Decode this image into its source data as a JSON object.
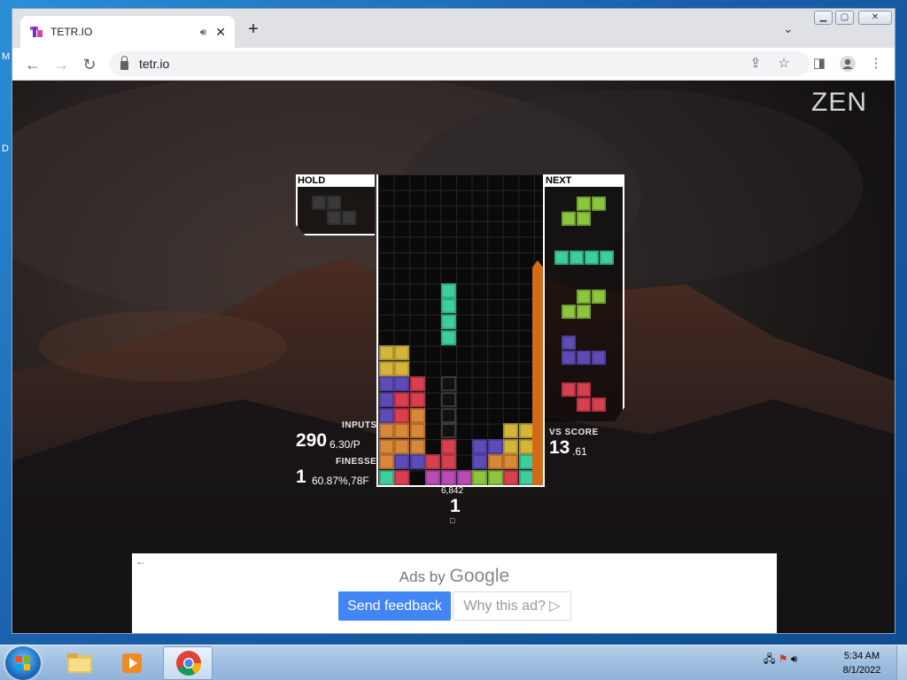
{
  "desktop": {
    "glyph_m": "M",
    "glyph_d": "D"
  },
  "browser": {
    "tab_title": "TETR.IO",
    "url": "tetr.io",
    "icons": {
      "speaker": "speaker-icon",
      "close": "close-icon",
      "new_tab": "plus-icon",
      "tab_search": "chevron-down-icon",
      "back": "arrow-left-icon",
      "forward": "arrow-right-icon",
      "reload": "reload-icon",
      "lock": "lock-icon",
      "share": "share-icon",
      "star": "star-icon",
      "side_panel": "side-panel-icon",
      "profile": "profile-icon",
      "menu": "kebab-icon"
    }
  },
  "game": {
    "mode": "ZEN",
    "hold_label": "HOLD",
    "next_label": "NEXT",
    "stats": {
      "inputs_label": "INPUTS",
      "inputs_value": "290",
      "inputs_sub": "6.30/P",
      "finesse_label": "FINESSE",
      "finesse_value": "1",
      "finesse_sub": "60.87%,78F",
      "vs_label": "VS SCORE",
      "vs_value": "13",
      "vs_decimal": ".61",
      "under_small": "6,842",
      "under_big": "1",
      "under_tiny": "□"
    },
    "colors": {
      "S": "#8cc63e",
      "Z": "#d8404f",
      "J": "#5d4bb8",
      "L": "#d88838",
      "O": "#d4b53a",
      "I": "#3dcf9a",
      "T": "#b74db3",
      "ghost": "#3a3a3a",
      "garbage_meter": "#d56a16"
    },
    "hold_piece": "Z",
    "next_queue": [
      "S",
      "I",
      "S",
      "J",
      "Z"
    ]
  },
  "ad": {
    "prefix": "Ads by ",
    "brand": "Google",
    "send_feedback": "Send feedback",
    "why_ad": "Why this ad? ▷"
  },
  "taskbar": {
    "time": "5:34 AM",
    "date": "8/1/2022"
  }
}
